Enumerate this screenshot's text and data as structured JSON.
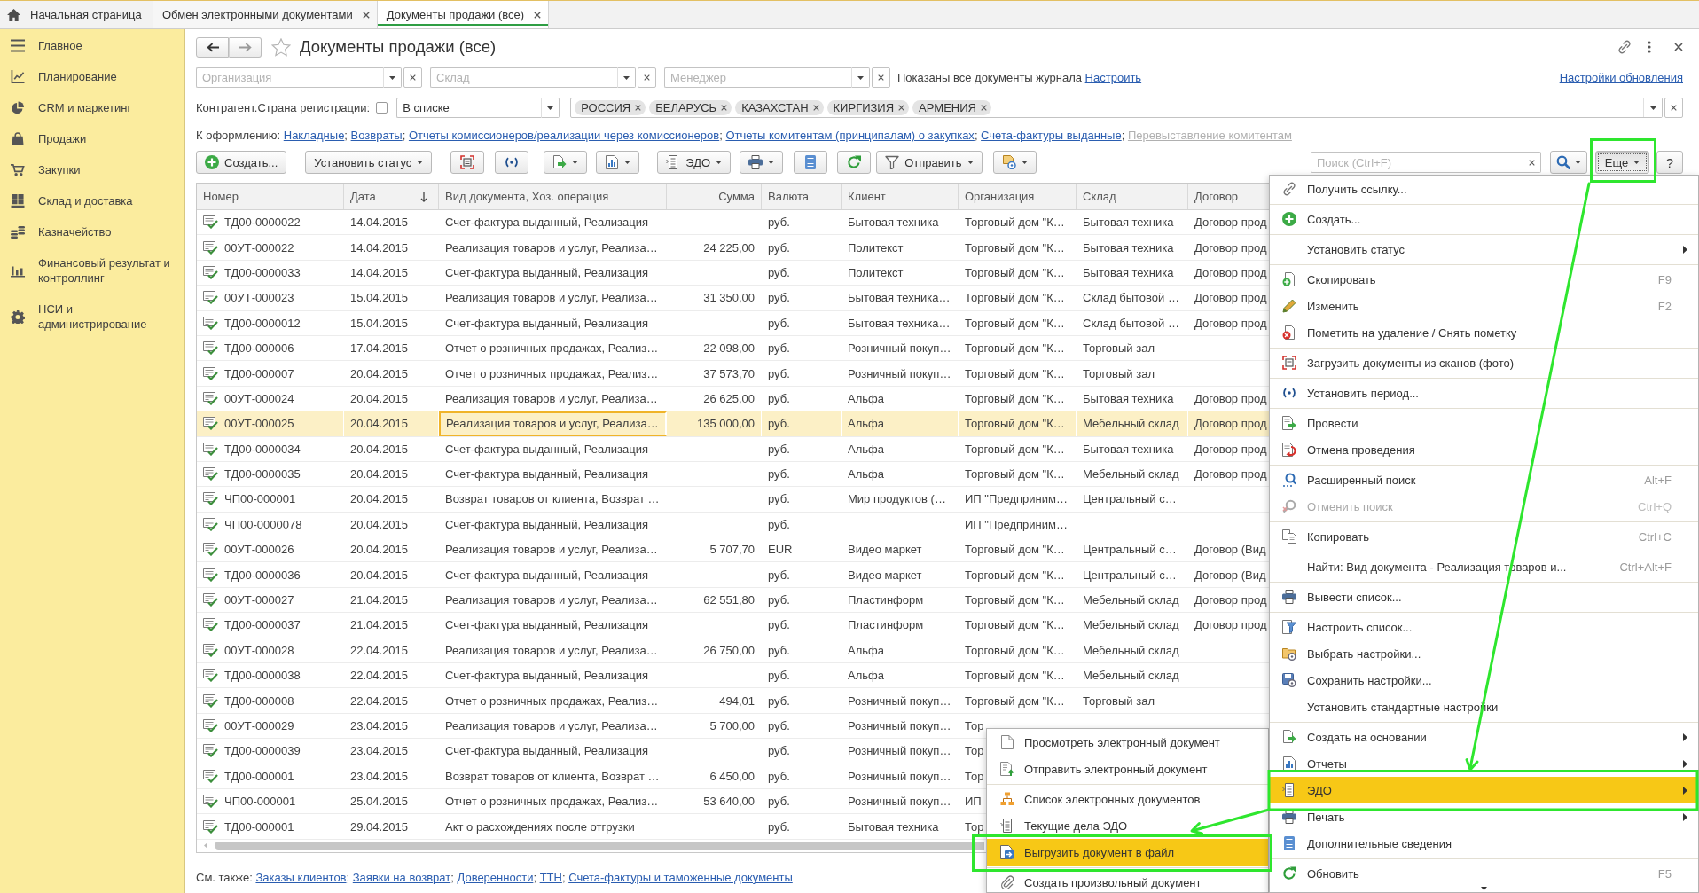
{
  "tabs": [
    {
      "label": "Начальная страница",
      "kind": "home",
      "selected": false
    },
    {
      "label": "Обмен электронными документами",
      "kind": "document",
      "selected": false
    },
    {
      "label": "Документы продажи (все)",
      "kind": "document",
      "selected": true
    }
  ],
  "sidebar": {
    "items": [
      "Главное",
      "Планирование",
      "CRM и маркетинг",
      "Продажи",
      "Закупки",
      "Склад и доставка",
      "Казначейство",
      "Финансовый результат и контроллинг",
      "НСИ и администрирование"
    ]
  },
  "header": {
    "title": "Документы продажи (все)"
  },
  "filters": {
    "fields": [
      {
        "placeholder": "Организация"
      },
      {
        "placeholder": "Склад"
      },
      {
        "placeholder": "Менеджер"
      }
    ],
    "note": "Показаны все документы журнала",
    "note_link": "Настроить",
    "settings_link": "Настройки обновления"
  },
  "country_filter": {
    "label": "Контрагент.Страна регистрации:",
    "checked": false,
    "condition": "В списке",
    "tags": [
      "РОССИЯ",
      "БЕЛАРУСЬ",
      "КАЗАХСТАН",
      "КИРГИЗИЯ",
      "АРМЕНИЯ"
    ]
  },
  "todo": {
    "label": "К оформлению:",
    "separator": ";",
    "links": [
      {
        "text": "Накладные",
        "disabled": false
      },
      {
        "text": "Возвраты",
        "disabled": false
      },
      {
        "text": "Отчеты комиссионеров/реализации через комиссионеров",
        "disabled": false
      },
      {
        "text": "Отчеты комитентам (принципалам) о закупках",
        "disabled": false
      },
      {
        "text": "Счета-фактуры выданные",
        "disabled": false
      },
      {
        "text": "Перевыставление комитентам",
        "disabled": true
      }
    ]
  },
  "toolbar": {
    "buttons": [
      {
        "label": "Создать...",
        "dropdown": false
      },
      {
        "label": "Установить статус",
        "dropdown": true
      },
      {
        "dropdown": false
      },
      {
        "dropdown": false
      },
      {
        "dropdown": true
      },
      {
        "dropdown": true
      },
      {
        "label": "ЭДО",
        "dropdown": true
      },
      {
        "dropdown": true
      },
      {
        "dropdown": false
      },
      {
        "dropdown": false
      },
      {
        "label": "Отправить",
        "dropdown": true
      },
      {
        "dropdown": true
      }
    ],
    "search": {
      "placeholder": "Поиск (Ctrl+F)"
    },
    "more": {
      "label": "Еще",
      "pressed": true
    },
    "help": "?"
  },
  "table": {
    "columns": [
      {
        "label": "Номер",
        "sorted": false,
        "current": false
      },
      {
        "label": "Дата",
        "sorted": true,
        "current": false
      },
      {
        "label": "Вид документа, Хоз. операция",
        "sorted": false,
        "current": true
      },
      {
        "label": "Сумма",
        "sorted": false,
        "current": false
      },
      {
        "label": "Валюта",
        "sorted": false,
        "current": false
      },
      {
        "label": "Клиент",
        "sorted": false,
        "current": false
      },
      {
        "label": "Организация",
        "sorted": false,
        "current": false
      },
      {
        "label": "Склад",
        "sorted": false,
        "current": false
      },
      {
        "label": "Договор",
        "sorted": false,
        "current": false
      }
    ],
    "rows": [
      {
        "number": "ТД00-0000022",
        "date": "14.04.2015",
        "operation": "Счет-фактура выданный, Реализация",
        "currency": "руб.",
        "client": "Бытовая техника",
        "organization": "Торговый дом \"К…",
        "warehouse": "Бытовая техника",
        "contract": "Договор прод",
        "selected": false
      },
      {
        "number": "00УТ-000022",
        "date": "14.04.2015",
        "operation": "Реализация товаров и услуг, Реализа…",
        "sum": "24 225,00",
        "currency": "руб.",
        "client": "Политекст",
        "organization": "Торговый дом \"К…",
        "warehouse": "Бытовая техника",
        "contract": "Договор прод",
        "selected": false
      },
      {
        "number": "ТД00-0000033",
        "date": "14.04.2015",
        "operation": "Счет-фактура выданный, Реализация",
        "currency": "руб.",
        "client": "Политекст",
        "organization": "Торговый дом \"К…",
        "warehouse": "Бытовая техника",
        "contract": "Договор прод",
        "selected": false
      },
      {
        "number": "00УТ-000023",
        "date": "15.04.2015",
        "operation": "Реализация товаров и услуг, Реализа…",
        "sum": "31 350,00",
        "currency": "руб.",
        "client": "Бытовая техника…",
        "organization": "Торговый дом \"К…",
        "warehouse": "Склад бытовой …",
        "contract": "Договор прод",
        "selected": false
      },
      {
        "number": "ТД00-0000012",
        "date": "15.04.2015",
        "operation": "Счет-фактура выданный, Реализация",
        "currency": "руб.",
        "client": "Бытовая техника…",
        "organization": "Торговый дом \"К…",
        "warehouse": "Склад бытовой …",
        "contract": "Договор прод",
        "selected": false
      },
      {
        "number": "ТД00-000006",
        "date": "17.04.2015",
        "operation": "Отчет о розничных продажах, Реализ…",
        "sum": "22 098,00",
        "currency": "руб.",
        "client": "Розничный покуп…",
        "organization": "Торговый дом \"К…",
        "warehouse": "Торговый зал",
        "selected": false
      },
      {
        "number": "ТД00-000007",
        "date": "20.04.2015",
        "operation": "Отчет о розничных продажах, Реализ…",
        "sum": "37 573,70",
        "currency": "руб.",
        "client": "Розничный покуп…",
        "organization": "Торговый дом \"К…",
        "warehouse": "Торговый зал",
        "selected": false
      },
      {
        "number": "00УТ-000024",
        "date": "20.04.2015",
        "operation": "Реализация товаров и услуг, Реализа…",
        "sum": "26 625,00",
        "currency": "руб.",
        "client": "Альфа",
        "organization": "Торговый дом \"К…",
        "warehouse": "Бытовая техника",
        "contract": "Договор прод",
        "selected": false
      },
      {
        "number": "00УТ-000025",
        "date": "20.04.2015",
        "operation": "Реализация товаров и услуг, Реализа…",
        "sum": "135 000,00",
        "currency": "руб.",
        "client": "Альфа",
        "organization": "Торговый дом \"К…",
        "warehouse": "Мебельный склад",
        "contract": "Договор прод",
        "selected": true
      },
      {
        "number": "ТД00-0000034",
        "date": "20.04.2015",
        "operation": "Счет-фактура выданный, Реализация",
        "currency": "руб.",
        "client": "Альфа",
        "organization": "Торговый дом \"К…",
        "warehouse": "Бытовая техника",
        "contract": "Договор прод",
        "selected": false
      },
      {
        "number": "ТД00-0000035",
        "date": "20.04.2015",
        "operation": "Счет-фактура выданный, Реализация",
        "currency": "руб.",
        "client": "Альфа",
        "organization": "Торговый дом \"К…",
        "warehouse": "Мебельный склад",
        "contract": "Договор прод",
        "selected": false
      },
      {
        "number": "ЧП00-000001",
        "date": "20.04.2015",
        "operation": "Возврат товаров от клиента, Возврат …",
        "currency": "руб.",
        "client": "Мир продуктов (…",
        "organization": "ИП \"Предприним…",
        "warehouse": "Центральный с…",
        "selected": false
      },
      {
        "number": "ЧП00-0000078",
        "date": "20.04.2015",
        "operation": "Счет-фактура выданный, Реализация",
        "currency": "руб.",
        "organization": "ИП \"Предприним…",
        "selected": false
      },
      {
        "number": "00УТ-000026",
        "date": "20.04.2015",
        "operation": "Реализация товаров и услуг, Реализа…",
        "sum": "5 707,70",
        "currency": "EUR",
        "client": "Видео маркет",
        "organization": "Торговый дом \"К…",
        "warehouse": "Центральный с…",
        "contract": "Договор (Вид",
        "selected": false
      },
      {
        "number": "ТД00-0000036",
        "date": "20.04.2015",
        "operation": "Счет-фактура выданный, Реализация",
        "currency": "руб.",
        "client": "Видео маркет",
        "organization": "Торговый дом \"К…",
        "warehouse": "Центральный с…",
        "contract": "Договор (Вид",
        "selected": false
      },
      {
        "number": "00УТ-000027",
        "date": "21.04.2015",
        "operation": "Реализация товаров и услуг, Реализа…",
        "sum": "62 551,80",
        "currency": "руб.",
        "client": "Пластинформ",
        "organization": "Торговый дом \"К…",
        "warehouse": "Мебельный склад",
        "contract": "Договор прод",
        "selected": false
      },
      {
        "number": "ТД00-0000037",
        "date": "21.04.2015",
        "operation": "Счет-фактура выданный, Реализация",
        "currency": "руб.",
        "client": "Пластинформ",
        "organization": "Торговый дом \"К…",
        "warehouse": "Мебельный склад",
        "contract": "Договор прод",
        "selected": false
      },
      {
        "number": "00УТ-000028",
        "date": "22.04.2015",
        "operation": "Реализация товаров и услуг, Реализа…",
        "sum": "26 750,00",
        "currency": "руб.",
        "client": "Альфа",
        "organization": "Торговый дом \"К…",
        "warehouse": "Мебельный склад",
        "selected": false
      },
      {
        "number": "ТД00-0000038",
        "date": "22.04.2015",
        "operation": "Счет-фактура выданный, Реализация",
        "currency": "руб.",
        "client": "Альфа",
        "organization": "Торговый дом \"К…",
        "warehouse": "Мебельный склад",
        "selected": false
      },
      {
        "number": "ТД00-000008",
        "date": "22.04.2015",
        "operation": "Отчет о розничных продажах, Реализ…",
        "sum": "494,01",
        "currency": "руб.",
        "client": "Розничный покуп…",
        "organization": "Торговый дом \"К…",
        "warehouse": "Торговый зал",
        "selected": false
      },
      {
        "number": "00УТ-000029",
        "date": "23.04.2015",
        "operation": "Реализация товаров и услуг, Реализа…",
        "sum": "5 700,00",
        "currency": "руб.",
        "client": "Розничный покуп…",
        "organization": "Тор",
        "selected": false
      },
      {
        "number": "ТД00-0000039",
        "date": "23.04.2015",
        "operation": "Счет-фактура выданный, Реализация",
        "currency": "руб.",
        "client": "Розничный покуп…",
        "organization": "Тор",
        "selected": false
      },
      {
        "number": "ТД00-000001",
        "date": "23.04.2015",
        "operation": "Возврат товаров от клиента, Возврат …",
        "sum": "6 450,00",
        "currency": "руб.",
        "client": "Розничный покуп…",
        "organization": "Тор",
        "selected": false
      },
      {
        "number": "ЧП00-000001",
        "date": "25.04.2015",
        "operation": "Отчет о розничных продажах, Реализ…",
        "sum": "53 640,00",
        "currency": "руб.",
        "client": "Розничный покуп…",
        "organization": "ИП",
        "selected": false
      },
      {
        "number": "ТД00-000001",
        "date": "29.04.2015",
        "operation": "Акт о расхождениях после отгрузки",
        "currency": "руб.",
        "client": "Бытовая техника",
        "organization": "Тор",
        "selected": false
      }
    ]
  },
  "see_also": {
    "label": "См. также:",
    "separator": ";",
    "links": [
      "Заказы клиентов",
      "Заявки на возврат",
      "Доверенности",
      "ТТН",
      "Счета-фактуры и таможенные документы"
    ]
  },
  "more_menu": {
    "groups": [
      {
        "items": [
          {
            "label": "Получить ссылку...",
            "submenu": false,
            "disabled": false,
            "selected": false
          }
        ]
      },
      {
        "items": [
          {
            "label": "Создать...",
            "submenu": false,
            "disabled": false,
            "selected": false
          }
        ]
      },
      {
        "items": [
          {
            "label": "Установить статус",
            "submenu": true,
            "disabled": false,
            "selected": false
          }
        ]
      },
      {
        "items": [
          {
            "label": "Скопировать",
            "shortcut": "F9",
            "submenu": false,
            "disabled": false,
            "selected": false
          },
          {
            "label": "Изменить",
            "shortcut": "F2",
            "submenu": false,
            "disabled": false,
            "selected": false
          },
          {
            "label": "Пометить на удаление / Снять пометку",
            "submenu": false,
            "disabled": false,
            "selected": false
          }
        ]
      },
      {
        "items": [
          {
            "label": "Загрузить документы из сканов (фото)",
            "submenu": false,
            "disabled": false,
            "selected": false
          }
        ]
      },
      {
        "items": [
          {
            "label": "Установить период...",
            "submenu": false,
            "disabled": false,
            "selected": false
          }
        ]
      },
      {
        "items": [
          {
            "label": "Провести",
            "submenu": false,
            "disabled": false,
            "selected": false
          },
          {
            "label": "Отмена проведения",
            "submenu": false,
            "disabled": false,
            "selected": false
          }
        ]
      },
      {
        "items": [
          {
            "label": "Расширенный поиск",
            "shortcut": "Alt+F",
            "submenu": false,
            "disabled": false,
            "selected": false
          },
          {
            "label": "Отменить поиск",
            "shortcut": "Ctrl+Q",
            "submenu": false,
            "disabled": true,
            "selected": false
          }
        ]
      },
      {
        "items": [
          {
            "label": "Копировать",
            "shortcut": "Ctrl+C",
            "submenu": false,
            "disabled": false,
            "selected": false
          }
        ]
      },
      {
        "items": [
          {
            "label": "Найти: Вид документа - Реализация товаров и...",
            "shortcut": "Ctrl+Alt+F",
            "submenu": false,
            "disabled": false,
            "selected": false
          }
        ]
      },
      {
        "items": [
          {
            "label": "Вывести список...",
            "submenu": false,
            "disabled": false,
            "selected": false
          }
        ]
      },
      {
        "items": [
          {
            "label": "Настроить список...",
            "submenu": false,
            "disabled": false,
            "selected": false
          },
          {
            "label": "Выбрать настройки...",
            "submenu": false,
            "disabled": false,
            "selected": false
          },
          {
            "label": "Сохранить настройки...",
            "submenu": false,
            "disabled": false,
            "selected": false
          },
          {
            "label": "Установить стандартные настройки",
            "submenu": false,
            "disabled": false,
            "selected": false
          }
        ]
      },
      {
        "items": [
          {
            "label": "Создать на основании",
            "submenu": true,
            "disabled": false,
            "selected": false
          },
          {
            "label": "Отчеты",
            "submenu": true,
            "disabled": false,
            "selected": false
          },
          {
            "label": "ЭДО",
            "submenu": true,
            "disabled": false,
            "selected": true
          },
          {
            "label": "Печать",
            "submenu": true,
            "disabled": false,
            "selected": false
          },
          {
            "label": "Дополнительные сведения",
            "submenu": false,
            "disabled": false,
            "selected": false
          }
        ]
      },
      {
        "items": [
          {
            "label": "Обновить",
            "shortcut": "F5",
            "submenu": false,
            "disabled": false,
            "selected": false
          }
        ]
      }
    ]
  },
  "edo_submenu": {
    "groups": [
      {
        "items": [
          {
            "label": "Просмотреть электронный документ",
            "selected": false
          },
          {
            "label": "Отправить электронный документ",
            "selected": false
          }
        ]
      },
      {
        "items": [
          {
            "label": "Список электронных документов",
            "selected": false
          },
          {
            "label": "Текущие дела ЭДО",
            "selected": false
          },
          {
            "label": "Выгрузить документ в файл",
            "selected": true
          }
        ]
      },
      {
        "items": [
          {
            "label": "Создать произвольный документ",
            "selected": false
          }
        ]
      }
    ]
  }
}
